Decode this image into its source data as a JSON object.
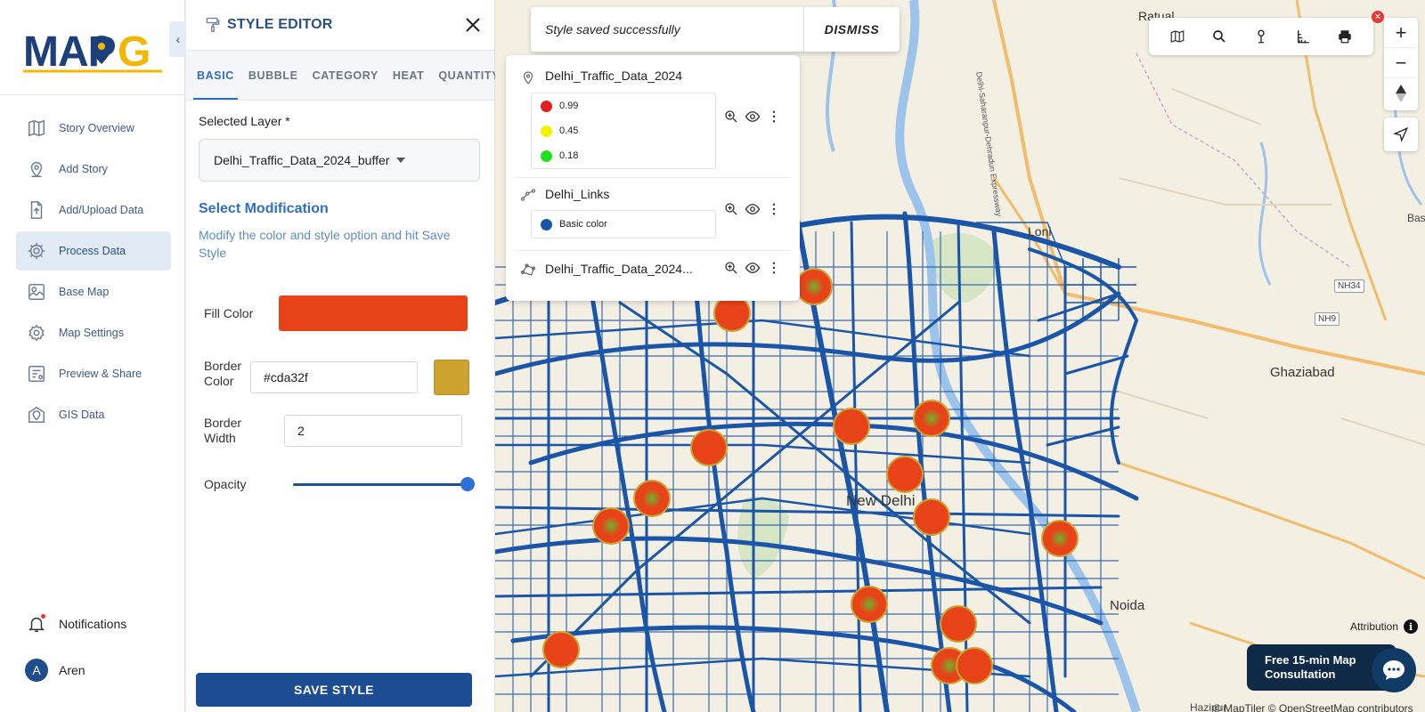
{
  "brand": {
    "logo_text": "MAPOG"
  },
  "sidebar": {
    "items": [
      {
        "label": "Story Overview",
        "icon": "map-icon"
      },
      {
        "label": "Add Story",
        "icon": "location-pin-icon"
      },
      {
        "label": "Add/Upload Data",
        "icon": "upload-file-icon"
      },
      {
        "label": "Process Data",
        "icon": "gear-icon",
        "active": true
      },
      {
        "label": "Base Map",
        "icon": "base-map-icon"
      },
      {
        "label": "Map Settings",
        "icon": "settings-icon"
      },
      {
        "label": "Preview & Share",
        "icon": "preview-icon"
      },
      {
        "label": "GIS Data",
        "icon": "gis-data-icon"
      }
    ],
    "notifications_label": "Notifications",
    "user": {
      "initial": "A",
      "name": "Aren"
    }
  },
  "editor": {
    "title": "STYLE EDITOR",
    "tabs": [
      {
        "label": "BASIC",
        "active": true
      },
      {
        "label": "BUBBLE"
      },
      {
        "label": "CATEGORY"
      },
      {
        "label": "HEAT"
      },
      {
        "label": "QUANTITY"
      }
    ],
    "selected_layer_label": "Selected Layer *",
    "selected_layer_value": "Delhi_Traffic_Data_2024_buffer",
    "modification_title": "Select Modification",
    "modification_desc": "Modify the color and style option and hit Save Style",
    "fill_color_label": "Fill Color",
    "fill_color": "#e84219",
    "border_color_label": "Border Color",
    "border_color_value": "#cda32f",
    "border_width_label": "Border Width",
    "border_width_value": "2",
    "opacity_label": "Opacity",
    "opacity_value": 1.0,
    "save_label": "SAVE STYLE"
  },
  "toast": {
    "message": "Style saved successfully",
    "dismiss_label": "DISMISS"
  },
  "layers_panel": {
    "layers": [
      {
        "name": "Delhi_Traffic_Data_2024",
        "legend": [
          {
            "label": "0.99",
            "color": "#e02020"
          },
          {
            "label": "0.45",
            "color": "#f5f000"
          },
          {
            "label": "0.18",
            "color": "#1fe01f"
          }
        ]
      },
      {
        "name": "Delhi_Links",
        "legend": [
          {
            "label": "Basic color",
            "color": "#1a55a8"
          }
        ]
      },
      {
        "name": "Delhi_Traffic_Data_2024..."
      }
    ]
  },
  "map": {
    "labels": {
      "ratual": "Ratual",
      "loni": "Loni",
      "ghaziabad": "Ghaziabad",
      "noida": "Noida",
      "hazipur": "Hazipur",
      "new_delhi": "New Delhi",
      "basa": "Basa",
      "expressway": "Delhi-Saharanpur-Dehradun Expressway"
    },
    "shields": {
      "nh34": "NH34",
      "nh9": "NH9"
    },
    "attribution_label": "Attribution",
    "copyright": "© MapTiler © OpenStreetMap contributors",
    "consult_text": "Free 15-min Map Consultation"
  },
  "colors": {
    "accent": "#2f6fbf",
    "primary_dark": "#1d4c92",
    "network_blue": "#1a55a8",
    "buffer_fill": "#e84219",
    "buffer_border": "#cda32f"
  }
}
